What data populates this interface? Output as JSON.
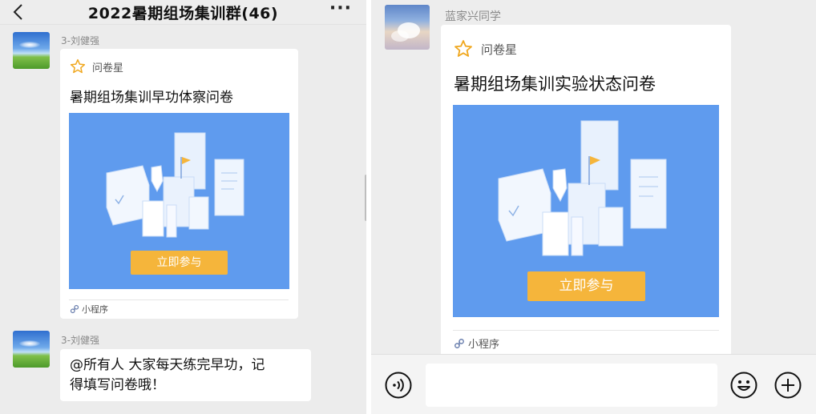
{
  "left": {
    "header": {
      "title": "2022暑期组场集训群(46)",
      "more": "···"
    },
    "messages": [
      {
        "sender": "3-刘健强",
        "card": {
          "app_name": "问卷星",
          "title": "暑期组场集训早功体察问卷",
          "button": "立即参与",
          "footer": "小程序"
        }
      },
      {
        "sender": "3-刘健强",
        "text_line1": "@所有人  大家每天练完早功，记",
        "text_line2": "得填写问卷哦！"
      }
    ]
  },
  "right": {
    "sender": "蓝家兴同学",
    "card": {
      "app_name": "问卷星",
      "title": "暑期组场集训实验状态问卷",
      "button": "立即参与",
      "footer": "小程序"
    },
    "input_bar": {
      "voice_icon": "voice-icon",
      "emoji_icon": "emoji-icon",
      "add_icon": "plus-icon"
    }
  },
  "colors": {
    "banner": "#5f9bee",
    "button": "#f5b53b",
    "background": "#ececec"
  }
}
